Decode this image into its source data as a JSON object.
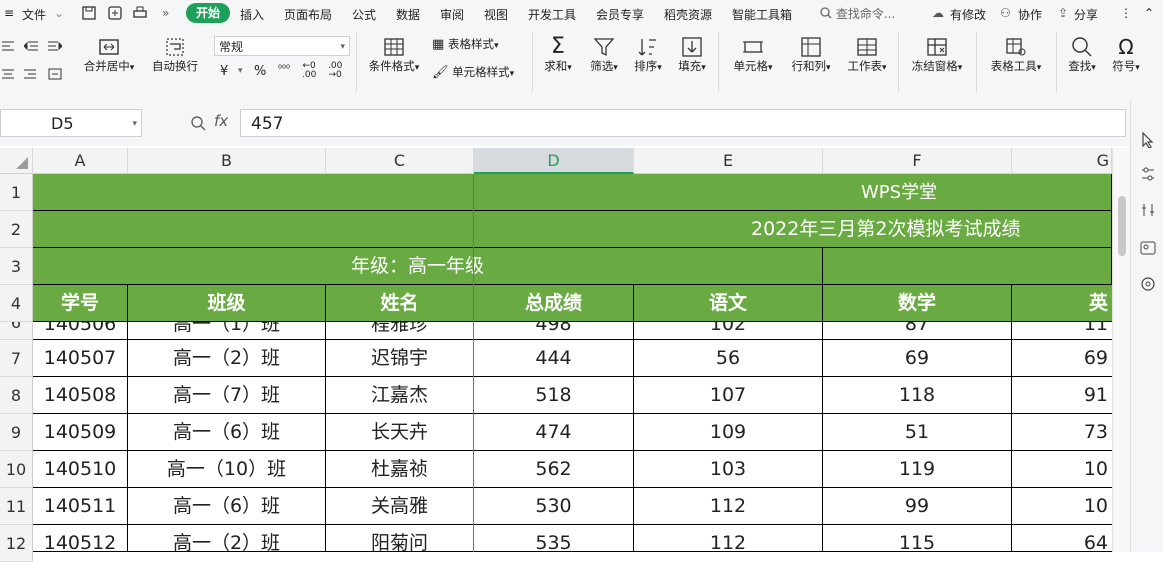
{
  "menubar": {
    "file": "文件",
    "tabs": [
      "插入",
      "页面布局",
      "公式",
      "数据",
      "审阅",
      "视图",
      "开发工具",
      "会员专享",
      "稻壳资源",
      "智能工具箱"
    ],
    "active_tab": "开始",
    "search_placeholder": "查找命令...",
    "right": [
      "有修改",
      "协作",
      "分享"
    ]
  },
  "ribbon": {
    "merge_center": "合并居中",
    "auto_wrap": "自动换行",
    "number_format": "常规",
    "currency": "¥",
    "percent": "%",
    "cond_format": "条件格式",
    "table_style": "表格样式",
    "cell_style": "单元格样式",
    "sum": "求和",
    "filter": "筛选",
    "sort": "排序",
    "fill": "填充",
    "cell": "单元格",
    "row_col": "行和列",
    "worksheet": "工作表",
    "freeze": "冻结窗格",
    "table_tools": "表格工具",
    "find": "查找",
    "symbol": "符号"
  },
  "formula_bar": {
    "name_box": "D5",
    "fx": "fx",
    "value": "457"
  },
  "columns": [
    "A",
    "B",
    "C",
    "D",
    "E",
    "F",
    "G"
  ],
  "rows": [
    "1",
    "2",
    "3",
    "4",
    "6",
    "7",
    "8",
    "9",
    "10",
    "11",
    "12"
  ],
  "sheet": {
    "title": "WPS学堂",
    "subtitle": "2022年三月第2次模拟考试成绩",
    "grade": "年级：高一年级",
    "headers": [
      "学号",
      "班级",
      "姓名",
      "总成绩",
      "语文",
      "数学",
      "英"
    ],
    "partial_row": [
      "140506",
      "高一（1）班",
      "程雅珍",
      "498",
      "102",
      "87",
      "11"
    ],
    "data": [
      [
        "140507",
        "高一（2）班",
        "迟锦宇",
        "444",
        "56",
        "69",
        "69"
      ],
      [
        "140508",
        "高一（7）班",
        "江嘉杰",
        "518",
        "107",
        "118",
        "91"
      ],
      [
        "140509",
        "高一（6）班",
        "长天卉",
        "474",
        "109",
        "51",
        "73"
      ],
      [
        "140510",
        "高一（10）班",
        "杜嘉祯",
        "562",
        "103",
        "119",
        "10"
      ],
      [
        "140511",
        "高一（6）班",
        "关高雅",
        "530",
        "112",
        "99",
        "10"
      ],
      [
        "140512",
        "高一（2）班",
        "阳菊问",
        "535",
        "112",
        "115",
        "64"
      ]
    ]
  },
  "colors": {
    "header_green": "#6aaa42",
    "active_tab": "#1fa05a"
  }
}
